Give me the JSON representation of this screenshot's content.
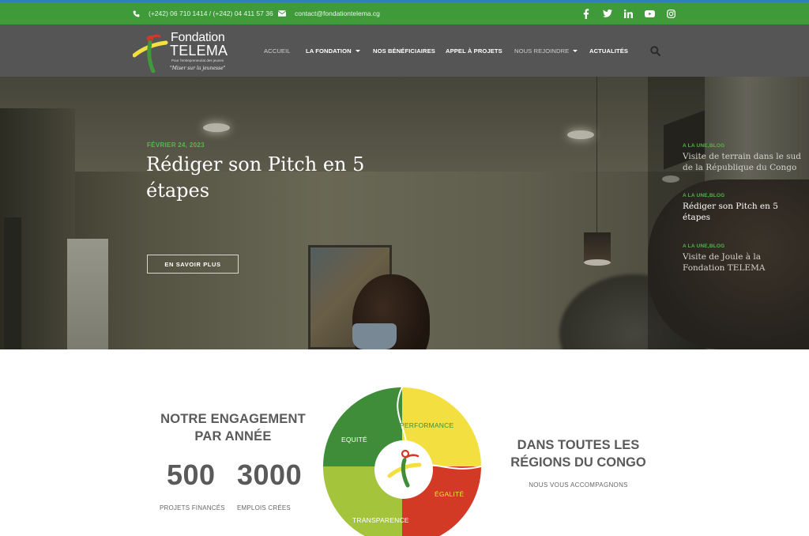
{
  "topbar": {
    "phone": "(+242) 06 710 1414 / (+242) 04 411 57 36",
    "email": "contact@fondationtelema.cg",
    "social_icons": [
      "facebook-icon",
      "twitter-icon",
      "linkedin-icon",
      "youtube-icon",
      "instagram-icon"
    ]
  },
  "logo": {
    "line1": "Fondation",
    "line2": "TELEMA",
    "tagline": "Pour l'entrepreneuriat des jeunes",
    "motto": "\"Miser sur la jeunesse\""
  },
  "nav": {
    "items": [
      {
        "label": "ACCUEIL"
      },
      {
        "label": "LA FONDATION"
      },
      {
        "label": "NOS BÉNÉFICIAIRES"
      },
      {
        "label": "APPEL À PROJETS"
      },
      {
        "label": "NOUS REJOINDRE"
      },
      {
        "label": "ACTUALITÉS"
      }
    ]
  },
  "hero": {
    "date": "FÉVRIER 24, 2023",
    "title": "Rédiger son Pitch en 5 étapes",
    "button": "EN SAVOIR PLUS"
  },
  "side_posts": [
    {
      "category": "A LA UNE,BLOG",
      "title": "Visite de terrain dans le sud de la République du Congo"
    },
    {
      "category": "A LA UNE,BLOG",
      "title": "Rédiger son Pitch en 5 étapes"
    },
    {
      "category": "A LA UNE,BLOG",
      "title": "Visite de Joule à la Fondation TELEMA"
    }
  ],
  "engagement": {
    "title_line1": "NOTRE ENGAGEMENT",
    "title_line2": "PAR ANNÉE",
    "stat1_value": "500",
    "stat1_label": "PROJETS FINANCÉS",
    "stat2_value": "3000",
    "stat2_label": "EMPLOIS CRÉES"
  },
  "values_wheel": {
    "segments": [
      {
        "label": "EQUITÉ",
        "color": "#3f8d38"
      },
      {
        "label": "PERFORMANCE",
        "color": "#f3e040"
      },
      {
        "label": "ÉGALITÉ",
        "color": "#d23a26"
      },
      {
        "label": "TRANSPARENCE",
        "color": "#a4c43c"
      }
    ]
  },
  "regions": {
    "title_line1": "DANS TOUTES LES",
    "title_line2": "RÉGIONS DU CONGO",
    "subtitle": "NOUS VOUS ACCOMPAGNONS"
  },
  "colors": {
    "topbar_green": "#3f9a3a",
    "header_gray": "#555555",
    "accent_green": "#57b84e"
  }
}
